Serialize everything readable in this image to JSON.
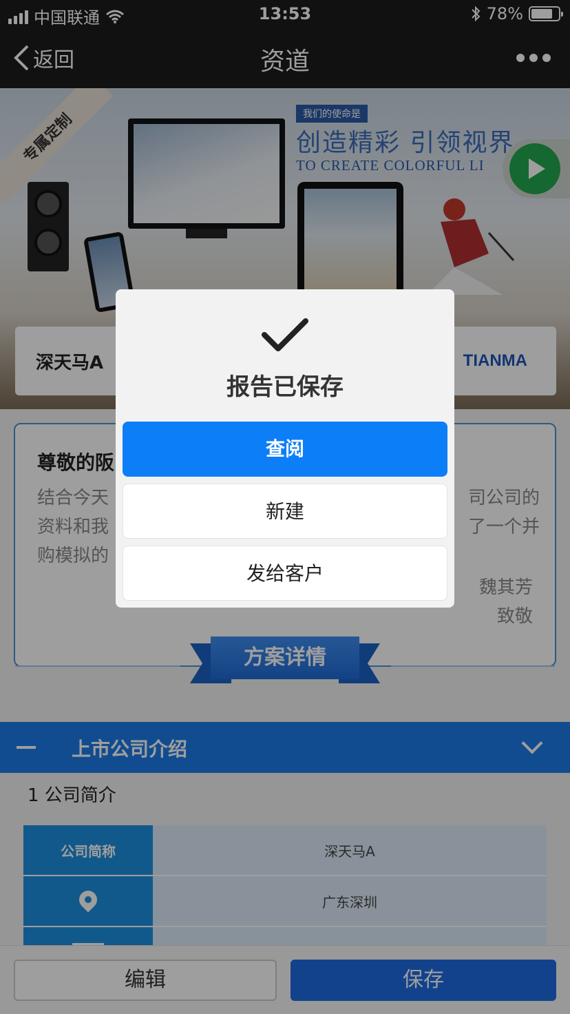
{
  "status_bar": {
    "carrier": "中国联通",
    "time": "13:53",
    "battery_percent": "78%",
    "battery_level": 0.78
  },
  "nav": {
    "back_label": "返回",
    "title": "资道"
  },
  "banner": {
    "ribbon": "专属定制",
    "slogan_small": "我们的使命是",
    "slogan_big": "创造精彩 引领视界",
    "slogan_en": "TO CREATE COLORFUL LI",
    "stock_name": "深天马A",
    "brand": "TIANMA"
  },
  "letter": {
    "greeting": "尊敬的阪",
    "line1_left": "结合今天",
    "line1_right": "司公司的",
    "line2_left": "资料和我",
    "line2_right": "了一个并",
    "line3_left": "购模拟的",
    "signer": "魏其芳",
    "closing": "致敬"
  },
  "scheme_label": "方案详情",
  "section": {
    "title": "上市公司介绍"
  },
  "company_intro": {
    "subtitle": "1 公司简介",
    "rows": [
      {
        "key": "公司简称",
        "value": "深天马A"
      },
      {
        "key": "",
        "icon": "location-pin-icon",
        "value": "广东深圳"
      },
      {
        "key": "",
        "icon": "building-icon",
        "value": ""
      }
    ]
  },
  "bottom_bar": {
    "edit_label": "编辑",
    "save_label": "保存"
  },
  "modal": {
    "message": "报告已保存",
    "view_label": "查阅",
    "new_label": "新建",
    "send_label": "发给客户"
  },
  "colors": {
    "primary": "#0c7ef7",
    "section_blue": "#1e7be8",
    "nav_dark": "#1c1c1e"
  }
}
